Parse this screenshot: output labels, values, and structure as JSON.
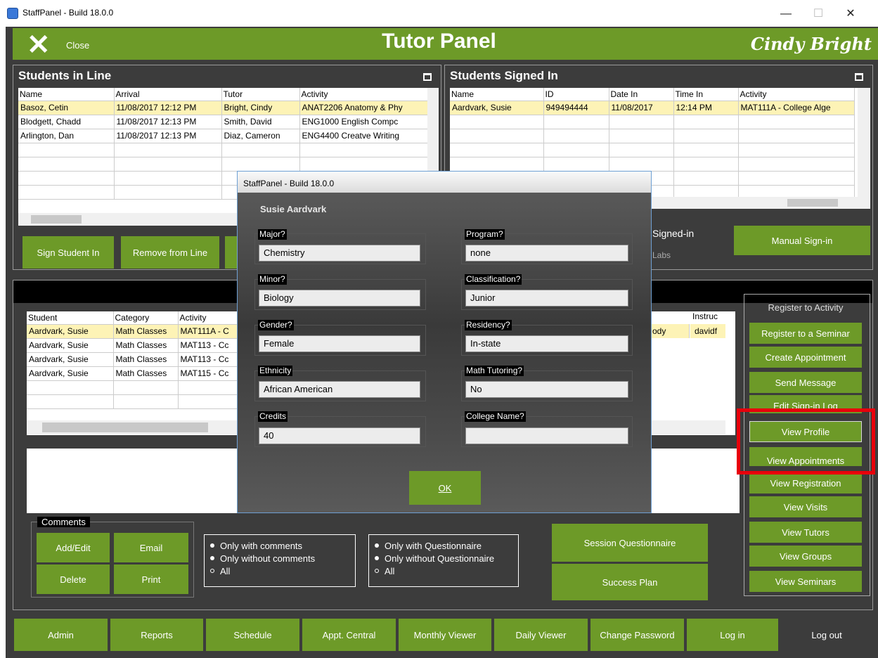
{
  "window": {
    "title": "StaffPanel - Build 18.0.0",
    "minimize_glyph": "—",
    "maximize_glyph": "☐",
    "close_glyph": "✕"
  },
  "header": {
    "close_glyph": "✕",
    "close_label": "Close",
    "title": "Tutor Panel",
    "user": "Cindy Bright"
  },
  "students_in_line": {
    "title": "Students in Line",
    "columns": [
      "Name",
      "Arrival",
      "Tutor",
      "Activity"
    ],
    "rows": [
      [
        "Basoz, Cetin",
        "11/08/2017 12:12 PM",
        "Bright, Cindy",
        "ANAT2206 Anatomy & Phy"
      ],
      [
        "Blodgett, Chadd",
        "11/08/2017 12:13 PM",
        "Smith, David",
        "ENG1000 English Compc"
      ],
      [
        "Arlington, Dan",
        "11/08/2017 12:13 PM",
        "Diaz, Cameron",
        "ENG4400 Creatve Writing"
      ]
    ],
    "buttons": [
      "Sign Student In",
      "Remove from Line"
    ]
  },
  "students_signed_in": {
    "title": "Students Signed In",
    "columns": [
      "Name",
      "ID",
      "Date In",
      "Time In",
      "Activity"
    ],
    "rows": [
      [
        "Aardvark, Susie",
        "949494444",
        "11/08/2017",
        "12:14 PM",
        "MAT111A - College Alge"
      ]
    ],
    "partial_text_1": "Signed-in",
    "partial_text_2": "Labs",
    "manual_sign_in": "Manual Sign-in"
  },
  "activities": {
    "columns": [
      "Student",
      "Category",
      "Activity"
    ],
    "right_columns": [
      "Instruc"
    ],
    "rows": [
      [
        "Aardvark, Susie",
        "Math Classes",
        "MAT111A - C"
      ],
      [
        "Aardvark, Susie",
        "Math Classes",
        "MAT113 - Cc"
      ],
      [
        "Aardvark, Susie",
        "Math Classes",
        "MAT113 - Cc"
      ],
      [
        "Aardvark, Susie",
        "Math Classes",
        "MAT115 - Cc"
      ]
    ],
    "right_row1": [
      "ody",
      "davidf"
    ]
  },
  "comments": {
    "label": "Comments",
    "buttons": [
      "Add/Edit",
      "Email",
      "Delete",
      "Print"
    ]
  },
  "comment_filter": {
    "options": [
      "Only with comments",
      "Only without comments",
      "All"
    ],
    "selected": "All"
  },
  "questionnaire_filter": {
    "options": [
      "Only with Questionnaire",
      "Only without Questionnaire",
      "All"
    ],
    "selected": "All"
  },
  "session_questionnaire": "Session Questionnaire",
  "success_plan": "Success Plan",
  "sidebar": {
    "header": "Register to Activity",
    "items": [
      "Register to a Seminar",
      "Create Appointment",
      "Send Message",
      "Edit Sign-in Log",
      "View Profile",
      "View Appointments",
      "View Registration",
      "View Visits",
      "View Tutors",
      "View Groups",
      "View Seminars"
    ],
    "highlight_color": "#e8000b"
  },
  "bottom_nav": [
    "Admin",
    "Reports",
    "Schedule",
    "Appt. Central",
    "Monthly Viewer",
    "Daily Viewer",
    "Change Password",
    "Log in",
    "Log out"
  ],
  "dialog": {
    "title": "StaffPanel - Build 18.0.0",
    "student_name": "Susie Aardvark",
    "fields_left": [
      {
        "label": "Major?",
        "value": "Chemistry"
      },
      {
        "label": "Minor?",
        "value": "Biology"
      },
      {
        "label": "Gender?",
        "value": "Female"
      },
      {
        "label": "Ethnicity",
        "value": "African American"
      },
      {
        "label": "Credits",
        "value": "40"
      }
    ],
    "fields_right": [
      {
        "label": "Program?",
        "value": "none"
      },
      {
        "label": "Classification?",
        "value": "Junior"
      },
      {
        "label": "Residency?",
        "value": "In-state"
      },
      {
        "label": "Math Tutoring?",
        "value": "No"
      },
      {
        "label": "College Name?",
        "value": ""
      }
    ],
    "ok_label": "OK"
  },
  "colors": {
    "accent": "#6d9a28",
    "background": "#3c3c3c",
    "selected_row": "#fdf3b6"
  }
}
